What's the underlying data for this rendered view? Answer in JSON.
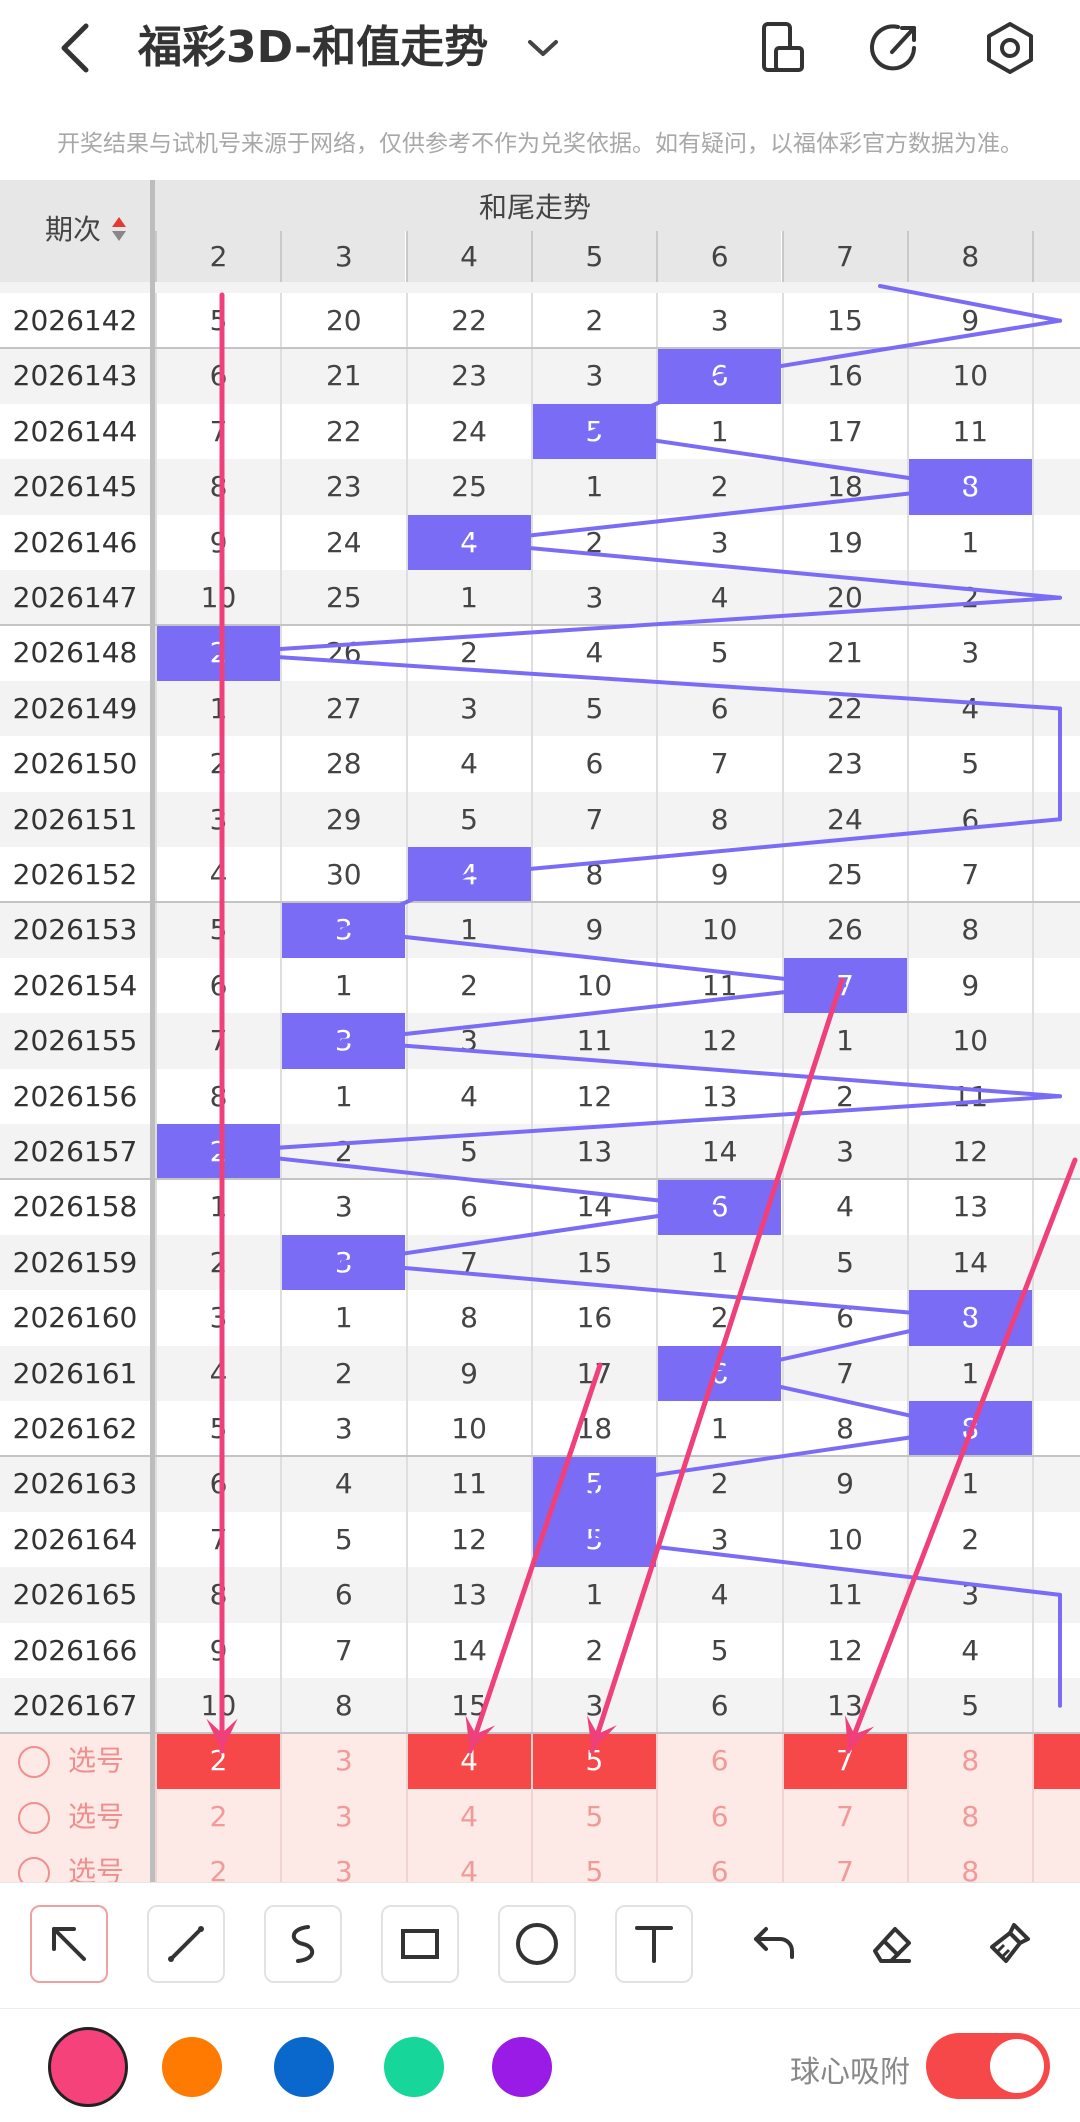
{
  "header": {
    "title": "福彩3D-和值走势",
    "notice": "开奖结果与试机号来源于网络，仅供参考不作为兑奖依据。如有疑问，以福体彩官方数据为准。"
  },
  "table": {
    "period_header": "期次",
    "group_header": "和尾走势",
    "columns": [
      "2",
      "3",
      "4",
      "5",
      "6",
      "7",
      "8"
    ],
    "rows": [
      {
        "period": "2026142",
        "values": [
          "5",
          "20",
          "22",
          "2",
          "3",
          "15",
          "9"
        ],
        "hit": -1
      },
      {
        "period": "2026143",
        "values": [
          "6",
          "21",
          "23",
          "3",
          "6",
          "16",
          "10"
        ],
        "hit": 4
      },
      {
        "period": "2026144",
        "values": [
          "7",
          "22",
          "24",
          "5",
          "1",
          "17",
          "11"
        ],
        "hit": 3
      },
      {
        "period": "2026145",
        "values": [
          "8",
          "23",
          "25",
          "1",
          "2",
          "18",
          "8"
        ],
        "hit": 6
      },
      {
        "period": "2026146",
        "values": [
          "9",
          "24",
          "4",
          "2",
          "3",
          "19",
          "1"
        ],
        "hit": 2
      },
      {
        "period": "2026147",
        "values": [
          "10",
          "25",
          "1",
          "3",
          "4",
          "20",
          "2"
        ],
        "hit": -1
      },
      {
        "period": "2026148",
        "values": [
          "2",
          "26",
          "2",
          "4",
          "5",
          "21",
          "3"
        ],
        "hit": 0
      },
      {
        "period": "2026149",
        "values": [
          "1",
          "27",
          "3",
          "5",
          "6",
          "22",
          "4"
        ],
        "hit": -1
      },
      {
        "period": "2026150",
        "values": [
          "2",
          "28",
          "4",
          "6",
          "7",
          "23",
          "5"
        ],
        "hit": -1
      },
      {
        "period": "2026151",
        "values": [
          "3",
          "29",
          "5",
          "7",
          "8",
          "24",
          "6"
        ],
        "hit": -1
      },
      {
        "period": "2026152",
        "values": [
          "4",
          "30",
          "4",
          "8",
          "9",
          "25",
          "7"
        ],
        "hit": 2
      },
      {
        "period": "2026153",
        "values": [
          "5",
          "3",
          "1",
          "9",
          "10",
          "26",
          "8"
        ],
        "hit": 1
      },
      {
        "period": "2026154",
        "values": [
          "6",
          "1",
          "2",
          "10",
          "11",
          "7",
          "9"
        ],
        "hit": 5
      },
      {
        "period": "2026155",
        "values": [
          "7",
          "3",
          "3",
          "11",
          "12",
          "1",
          "10"
        ],
        "hit": 1
      },
      {
        "period": "2026156",
        "values": [
          "8",
          "1",
          "4",
          "12",
          "13",
          "2",
          "11"
        ],
        "hit": -1
      },
      {
        "period": "2026157",
        "values": [
          "2",
          "2",
          "5",
          "13",
          "14",
          "3",
          "12"
        ],
        "hit": 0
      },
      {
        "period": "2026158",
        "values": [
          "1",
          "3",
          "6",
          "14",
          "6",
          "4",
          "13"
        ],
        "hit": 4
      },
      {
        "period": "2026159",
        "values": [
          "2",
          "3",
          "7",
          "15",
          "1",
          "5",
          "14"
        ],
        "hit": 1
      },
      {
        "period": "2026160",
        "values": [
          "3",
          "1",
          "8",
          "16",
          "2",
          "6",
          "8"
        ],
        "hit": 6
      },
      {
        "period": "2026161",
        "values": [
          "4",
          "2",
          "9",
          "17",
          "6",
          "7",
          "1"
        ],
        "hit": 4
      },
      {
        "period": "2026162",
        "values": [
          "5",
          "3",
          "10",
          "18",
          "1",
          "8",
          "8"
        ],
        "hit": 6
      },
      {
        "period": "2026163",
        "values": [
          "6",
          "4",
          "11",
          "5",
          "2",
          "9",
          "1"
        ],
        "hit": 3
      },
      {
        "period": "2026164",
        "values": [
          "7",
          "5",
          "12",
          "5",
          "3",
          "10",
          "2"
        ],
        "hit": 3
      },
      {
        "period": "2026165",
        "values": [
          "8",
          "6",
          "13",
          "1",
          "4",
          "11",
          "3"
        ],
        "hit": -1
      },
      {
        "period": "2026166",
        "values": [
          "9",
          "7",
          "14",
          "2",
          "5",
          "12",
          "4"
        ],
        "hit": -1
      },
      {
        "period": "2026167",
        "values": [
          "10",
          "8",
          "15",
          "3",
          "6",
          "13",
          "5"
        ],
        "hit": -1
      }
    ],
    "select_rows": [
      {
        "label": "选号",
        "values": [
          "2",
          "3",
          "4",
          "5",
          "6",
          "7",
          "8"
        ],
        "picked": [
          0,
          2,
          3,
          5
        ]
      },
      {
        "label": "选号",
        "values": [
          "2",
          "3",
          "4",
          "5",
          "6",
          "7",
          "8"
        ],
        "picked": []
      },
      {
        "label": "选号",
        "values": [
          "2",
          "3",
          "4",
          "5",
          "6",
          "7",
          "8"
        ],
        "picked": []
      }
    ]
  },
  "toolbar": {
    "tools": [
      "pointer-tool",
      "line-tool",
      "curve-tool",
      "rectangle-tool",
      "circle-tool",
      "text-tool",
      "undo-tool",
      "eraser-tool",
      "clear-tool"
    ],
    "active_tool": "pointer-tool"
  },
  "colors": {
    "swatches": [
      "#f5427a",
      "#ff7a00",
      "#0a67cc",
      "#16d69a",
      "#9a1be6"
    ],
    "selected": "#f5427a",
    "hit_fill": "#7b6cf6",
    "trend_line": "#7b6cf6",
    "arrow": "#f0407a",
    "pick_fill": "#f64848"
  },
  "bottom": {
    "snap_label": "球心吸附",
    "snap_on": true
  }
}
